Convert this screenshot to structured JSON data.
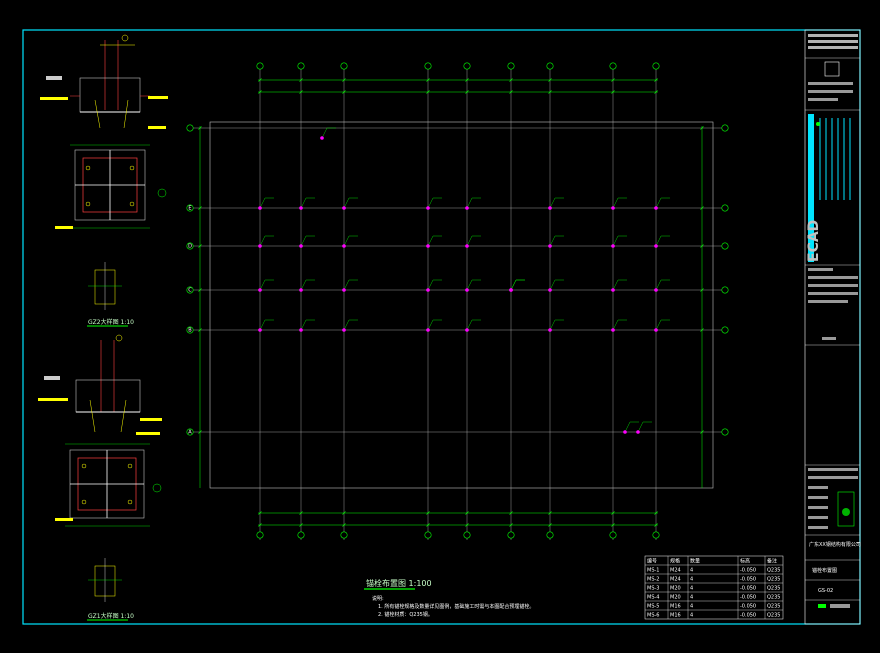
{
  "plan": {
    "title": "锚栓布置图 1:100",
    "axis_left": [
      "E",
      "D",
      "C",
      "B",
      "A"
    ],
    "notes_heading": "说明:",
    "notes": [
      "1. 所有锚栓规格及数量详见图例，基础施工时需与本图配合预埋锚栓。",
      "2. 锚栓材质：Q235钢。"
    ]
  },
  "details": {
    "top_title": "GZ2大样图 1:10",
    "bottom_title": "GZ1大样图 1:10"
  },
  "legend": {
    "headers": [
      "编号",
      "规格",
      "数量",
      "标高",
      "备注"
    ],
    "rows": [
      [
        "MS-1",
        "M24",
        "4",
        "-0.050",
        "Q235"
      ],
      [
        "MS-2",
        "M24",
        "4",
        "-0.050",
        "Q235"
      ],
      [
        "MS-3",
        "M20",
        "4",
        "-0.050",
        "Q235"
      ],
      [
        "MS-4",
        "M20",
        "4",
        "-0.050",
        "Q235"
      ],
      [
        "MS-5",
        "M16",
        "4",
        "-0.050",
        "Q235"
      ],
      [
        "MS-6",
        "M16",
        "4",
        "-0.050",
        "Q235"
      ]
    ]
  },
  "title_block": {
    "logo": "ECAD",
    "company": "广东XX钢结构有限公司",
    "drawing_name": "锚栓布置图",
    "drawing_no": "GS-02"
  },
  "colors": {
    "border": "#00e5ff",
    "grid": "#c0c0c0",
    "dimension": "#00ff00",
    "anchor": "#ff00ff",
    "text": "#ffffff",
    "highlight": "#ffff00"
  }
}
